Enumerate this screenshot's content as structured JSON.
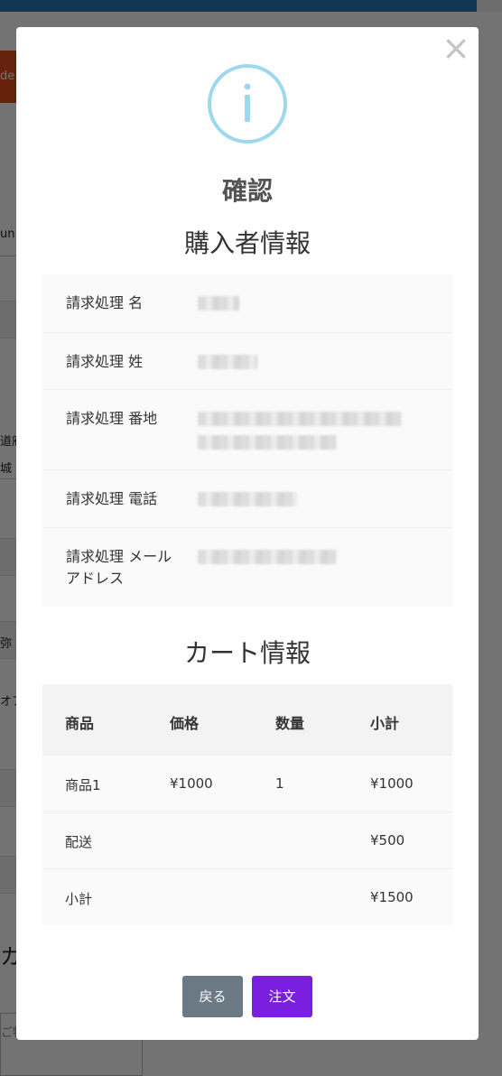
{
  "background": {
    "red_button_fragment": "de",
    "text_fragments": [
      "un",
      "道府",
      "城",
      "弥",
      "オフ"
    ],
    "large_fragment": "カ",
    "textarea_fragment": "ご特"
  },
  "modal": {
    "close_glyph": "×",
    "icon_glyph": "i",
    "title": "確認",
    "buyer_section_title": "購入者情報",
    "buyer_rows": [
      {
        "label": "請求処理 名"
      },
      {
        "label": "請求処理 姓"
      },
      {
        "label": "請求処理 番地"
      },
      {
        "label": "請求処理 電話"
      },
      {
        "label": "請求処理 メールアドレス"
      }
    ],
    "cart_section_title": "カート情報",
    "cart_headers": [
      "商品",
      "価格",
      "数量",
      "小計"
    ],
    "cart_rows": [
      [
        "商品1",
        "¥1000",
        "1",
        "¥1000"
      ],
      [
        "配送",
        "",
        "",
        "¥500"
      ],
      [
        "小計",
        "",
        "",
        "¥1500"
      ]
    ],
    "back_button": "戻る",
    "order_button": "注文"
  },
  "colors": {
    "accent_order": "#7a1fe0",
    "back_button": "#6c7a86",
    "info_icon": "#9dd8ef",
    "top_bar": "#2b7ab8"
  }
}
